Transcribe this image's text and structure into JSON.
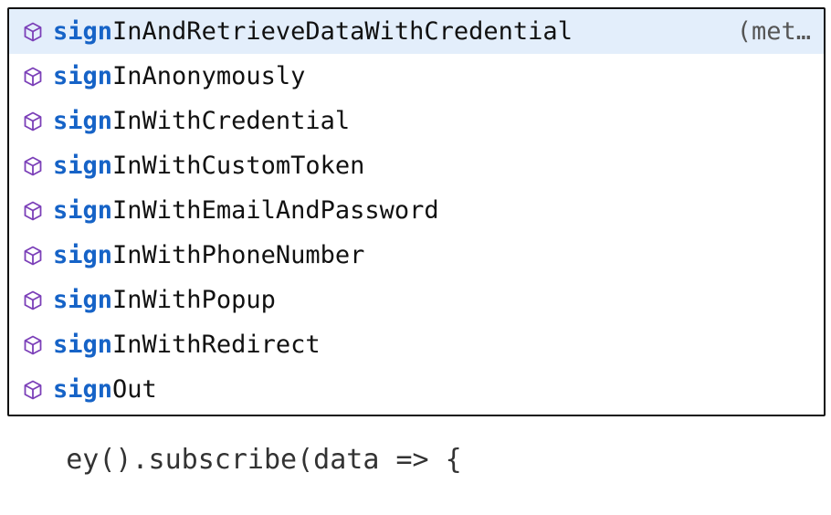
{
  "background_code": {
    "bottom_line": "ey().subscribe(data => {"
  },
  "suggest_widget": {
    "query": "sign",
    "items": [
      {
        "match": "sign",
        "rest": "InAndRetrieveDataWithCredential",
        "detail": "(met…",
        "icon": "method-cube-icon",
        "selected": true
      },
      {
        "match": "sign",
        "rest": "InAnonymously",
        "detail": "",
        "icon": "method-cube-icon",
        "selected": false
      },
      {
        "match": "sign",
        "rest": "InWithCredential",
        "detail": "",
        "icon": "method-cube-icon",
        "selected": false
      },
      {
        "match": "sign",
        "rest": "InWithCustomToken",
        "detail": "",
        "icon": "method-cube-icon",
        "selected": false
      },
      {
        "match": "sign",
        "rest": "InWithEmailAndPassword",
        "detail": "",
        "icon": "method-cube-icon",
        "selected": false
      },
      {
        "match": "sign",
        "rest": "InWithPhoneNumber",
        "detail": "",
        "icon": "method-cube-icon",
        "selected": false
      },
      {
        "match": "sign",
        "rest": "InWithPopup",
        "detail": "",
        "icon": "method-cube-icon",
        "selected": false
      },
      {
        "match": "sign",
        "rest": "InWithRedirect",
        "detail": "",
        "icon": "method-cube-icon",
        "selected": false
      },
      {
        "match": "sign",
        "rest": "Out",
        "detail": "",
        "icon": "method-cube-icon",
        "selected": false
      }
    ]
  },
  "colors": {
    "match": "#1663c7",
    "selected_bg": "#e3eefb",
    "icon": "#7b3fb8"
  }
}
